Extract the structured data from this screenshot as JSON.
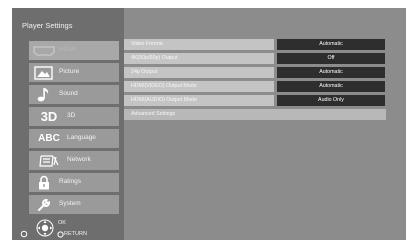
{
  "title": "Player Settings",
  "nav": [
    {
      "label": "HDMI",
      "icon": "hdmi-icon",
      "selected": true
    },
    {
      "label": "Picture",
      "icon": "picture-icon",
      "selected": false
    },
    {
      "label": "Sound",
      "icon": "sound-icon",
      "selected": false
    },
    {
      "label": "3D",
      "icon": "3d-icon",
      "icon_text": "3D",
      "selected": false
    },
    {
      "label": "Language",
      "icon": "language-icon",
      "icon_text": "ABC",
      "selected": false
    },
    {
      "label": "Network",
      "icon": "network-icon",
      "selected": false
    },
    {
      "label": "Ratings",
      "icon": "lock-icon",
      "selected": false
    },
    {
      "label": "System",
      "icon": "wrench-icon",
      "selected": false
    }
  ],
  "controls": {
    "ok": "OK",
    "return": "RETURN"
  },
  "settings": [
    {
      "label": "Video Format",
      "value": "Automatic"
    },
    {
      "label": "4K(50p/60p) Output",
      "value": "Off"
    },
    {
      "label": "24p Output",
      "value": "Automatic"
    },
    {
      "label": "HDMI(VIDEO) Output Mode",
      "value": "Automatic"
    },
    {
      "label": "HDMI(AUDIO) Output Mode",
      "value": "Audio Only"
    },
    {
      "label": "Advanced Settings"
    }
  ],
  "colors": {
    "background": "#8c8c8c",
    "sidebar": "#6e6e6e",
    "value_box": "#2e2e2e",
    "label_row": "#c4c4c4"
  }
}
